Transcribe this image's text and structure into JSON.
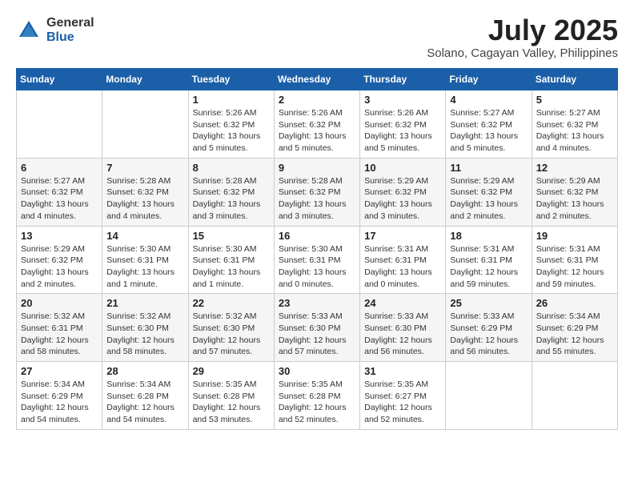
{
  "logo": {
    "general": "General",
    "blue": "Blue"
  },
  "title": {
    "month": "July 2025",
    "location": "Solano, Cagayan Valley, Philippines"
  },
  "days_of_week": [
    "Sunday",
    "Monday",
    "Tuesday",
    "Wednesday",
    "Thursday",
    "Friday",
    "Saturday"
  ],
  "weeks": [
    [
      {
        "day": null
      },
      {
        "day": null
      },
      {
        "day": "1",
        "sunrise": "Sunrise: 5:26 AM",
        "sunset": "Sunset: 6:32 PM",
        "daylight": "Daylight: 13 hours and 5 minutes."
      },
      {
        "day": "2",
        "sunrise": "Sunrise: 5:26 AM",
        "sunset": "Sunset: 6:32 PM",
        "daylight": "Daylight: 13 hours and 5 minutes."
      },
      {
        "day": "3",
        "sunrise": "Sunrise: 5:26 AM",
        "sunset": "Sunset: 6:32 PM",
        "daylight": "Daylight: 13 hours and 5 minutes."
      },
      {
        "day": "4",
        "sunrise": "Sunrise: 5:27 AM",
        "sunset": "Sunset: 6:32 PM",
        "daylight": "Daylight: 13 hours and 5 minutes."
      },
      {
        "day": "5",
        "sunrise": "Sunrise: 5:27 AM",
        "sunset": "Sunset: 6:32 PM",
        "daylight": "Daylight: 13 hours and 4 minutes."
      }
    ],
    [
      {
        "day": "6",
        "sunrise": "Sunrise: 5:27 AM",
        "sunset": "Sunset: 6:32 PM",
        "daylight": "Daylight: 13 hours and 4 minutes."
      },
      {
        "day": "7",
        "sunrise": "Sunrise: 5:28 AM",
        "sunset": "Sunset: 6:32 PM",
        "daylight": "Daylight: 13 hours and 4 minutes."
      },
      {
        "day": "8",
        "sunrise": "Sunrise: 5:28 AM",
        "sunset": "Sunset: 6:32 PM",
        "daylight": "Daylight: 13 hours and 3 minutes."
      },
      {
        "day": "9",
        "sunrise": "Sunrise: 5:28 AM",
        "sunset": "Sunset: 6:32 PM",
        "daylight": "Daylight: 13 hours and 3 minutes."
      },
      {
        "day": "10",
        "sunrise": "Sunrise: 5:29 AM",
        "sunset": "Sunset: 6:32 PM",
        "daylight": "Daylight: 13 hours and 3 minutes."
      },
      {
        "day": "11",
        "sunrise": "Sunrise: 5:29 AM",
        "sunset": "Sunset: 6:32 PM",
        "daylight": "Daylight: 13 hours and 2 minutes."
      },
      {
        "day": "12",
        "sunrise": "Sunrise: 5:29 AM",
        "sunset": "Sunset: 6:32 PM",
        "daylight": "Daylight: 13 hours and 2 minutes."
      }
    ],
    [
      {
        "day": "13",
        "sunrise": "Sunrise: 5:29 AM",
        "sunset": "Sunset: 6:32 PM",
        "daylight": "Daylight: 13 hours and 2 minutes."
      },
      {
        "day": "14",
        "sunrise": "Sunrise: 5:30 AM",
        "sunset": "Sunset: 6:31 PM",
        "daylight": "Daylight: 13 hours and 1 minute."
      },
      {
        "day": "15",
        "sunrise": "Sunrise: 5:30 AM",
        "sunset": "Sunset: 6:31 PM",
        "daylight": "Daylight: 13 hours and 1 minute."
      },
      {
        "day": "16",
        "sunrise": "Sunrise: 5:30 AM",
        "sunset": "Sunset: 6:31 PM",
        "daylight": "Daylight: 13 hours and 0 minutes."
      },
      {
        "day": "17",
        "sunrise": "Sunrise: 5:31 AM",
        "sunset": "Sunset: 6:31 PM",
        "daylight": "Daylight: 13 hours and 0 minutes."
      },
      {
        "day": "18",
        "sunrise": "Sunrise: 5:31 AM",
        "sunset": "Sunset: 6:31 PM",
        "daylight": "Daylight: 12 hours and 59 minutes."
      },
      {
        "day": "19",
        "sunrise": "Sunrise: 5:31 AM",
        "sunset": "Sunset: 6:31 PM",
        "daylight": "Daylight: 12 hours and 59 minutes."
      }
    ],
    [
      {
        "day": "20",
        "sunrise": "Sunrise: 5:32 AM",
        "sunset": "Sunset: 6:31 PM",
        "daylight": "Daylight: 12 hours and 58 minutes."
      },
      {
        "day": "21",
        "sunrise": "Sunrise: 5:32 AM",
        "sunset": "Sunset: 6:30 PM",
        "daylight": "Daylight: 12 hours and 58 minutes."
      },
      {
        "day": "22",
        "sunrise": "Sunrise: 5:32 AM",
        "sunset": "Sunset: 6:30 PM",
        "daylight": "Daylight: 12 hours and 57 minutes."
      },
      {
        "day": "23",
        "sunrise": "Sunrise: 5:33 AM",
        "sunset": "Sunset: 6:30 PM",
        "daylight": "Daylight: 12 hours and 57 minutes."
      },
      {
        "day": "24",
        "sunrise": "Sunrise: 5:33 AM",
        "sunset": "Sunset: 6:30 PM",
        "daylight": "Daylight: 12 hours and 56 minutes."
      },
      {
        "day": "25",
        "sunrise": "Sunrise: 5:33 AM",
        "sunset": "Sunset: 6:29 PM",
        "daylight": "Daylight: 12 hours and 56 minutes."
      },
      {
        "day": "26",
        "sunrise": "Sunrise: 5:34 AM",
        "sunset": "Sunset: 6:29 PM",
        "daylight": "Daylight: 12 hours and 55 minutes."
      }
    ],
    [
      {
        "day": "27",
        "sunrise": "Sunrise: 5:34 AM",
        "sunset": "Sunset: 6:29 PM",
        "daylight": "Daylight: 12 hours and 54 minutes."
      },
      {
        "day": "28",
        "sunrise": "Sunrise: 5:34 AM",
        "sunset": "Sunset: 6:28 PM",
        "daylight": "Daylight: 12 hours and 54 minutes."
      },
      {
        "day": "29",
        "sunrise": "Sunrise: 5:35 AM",
        "sunset": "Sunset: 6:28 PM",
        "daylight": "Daylight: 12 hours and 53 minutes."
      },
      {
        "day": "30",
        "sunrise": "Sunrise: 5:35 AM",
        "sunset": "Sunset: 6:28 PM",
        "daylight": "Daylight: 12 hours and 52 minutes."
      },
      {
        "day": "31",
        "sunrise": "Sunrise: 5:35 AM",
        "sunset": "Sunset: 6:27 PM",
        "daylight": "Daylight: 12 hours and 52 minutes."
      },
      {
        "day": null
      },
      {
        "day": null
      }
    ]
  ]
}
